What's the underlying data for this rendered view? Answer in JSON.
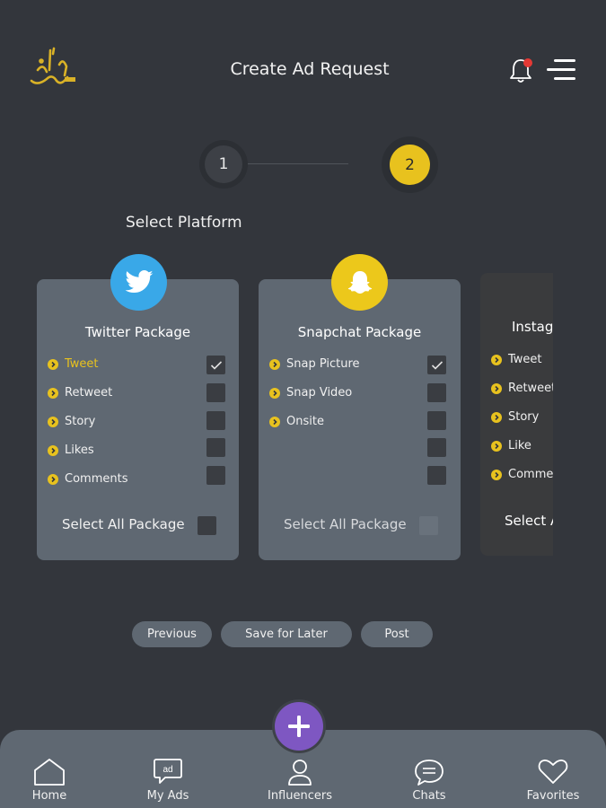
{
  "header": {
    "title": "Create Ad Request",
    "logo_icon": "calligraphy-logo",
    "notification_icon": "bell-icon",
    "menu_icon": "menu-icon"
  },
  "stepper": {
    "steps": [
      "1",
      "2"
    ],
    "active_step": 2
  },
  "section_title": "Select Platform",
  "packages": [
    {
      "title": "Twitter Package",
      "icon": "twitter-icon",
      "items": [
        {
          "label": "Tweet",
          "checked": true,
          "active": true
        },
        {
          "label": "Retweet",
          "checked": false
        },
        {
          "label": "Story",
          "checked": false
        },
        {
          "label": "Likes",
          "checked": false
        },
        {
          "label": "Comments",
          "checked": false
        }
      ],
      "select_all_label": "Select All Package"
    },
    {
      "title": "Snapchat Package",
      "icon": "snapchat-icon",
      "items": [
        {
          "label": "Snap Picture",
          "checked": true
        },
        {
          "label": "Snap Video",
          "checked": false
        },
        {
          "label": "Onsite",
          "checked": false
        },
        {
          "label": "",
          "checked": false
        },
        {
          "label": "",
          "checked": false
        }
      ],
      "select_all_label": "Select All Package"
    },
    {
      "title": "Instag",
      "items": [
        {
          "label": "Tweet"
        },
        {
          "label": "Retweet"
        },
        {
          "label": "Story"
        },
        {
          "label": "Like"
        },
        {
          "label": "Comme"
        }
      ],
      "select_all_label": "Select A"
    }
  ],
  "buttons": {
    "previous": "Previous",
    "save": "Save for Later",
    "post": "Post"
  },
  "bottom_nav": [
    {
      "label": "Home",
      "icon": "home-icon"
    },
    {
      "label": "My Ads",
      "icon": "ad-icon"
    },
    {
      "label": "Influencers",
      "icon": "user-icon"
    },
    {
      "label": "Chats",
      "icon": "chat-icon"
    },
    {
      "label": "Favorites",
      "icon": "heart-icon"
    }
  ],
  "fab_icon": "plus-icon",
  "colors": {
    "background": "#33363c",
    "card": "#5f6872",
    "accent": "#e8c21e",
    "twitter": "#39a8e8",
    "snapchat": "#ecc81b",
    "fab": "#7e57c2",
    "notification_dot": "#e53935"
  }
}
